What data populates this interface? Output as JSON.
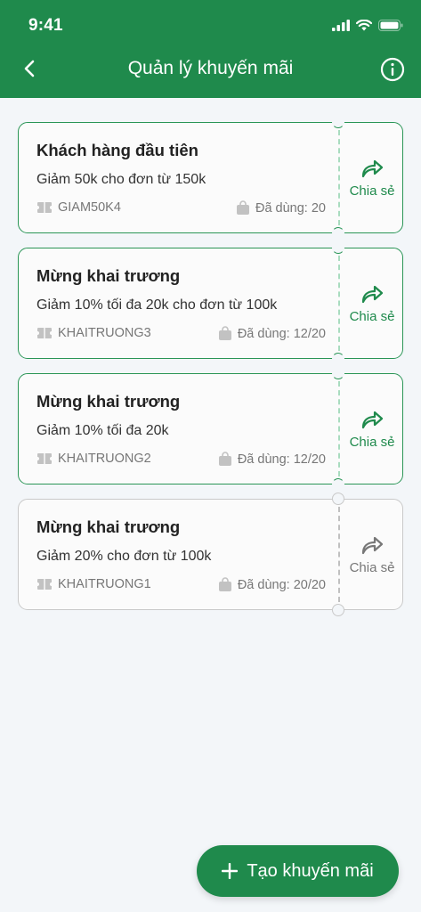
{
  "status_bar": {
    "time": "9:41"
  },
  "nav": {
    "title": "Quản lý khuyến mãi"
  },
  "promotions": [
    {
      "title": "Khách hàng đầu tiên",
      "description": "Giảm 50k cho đơn từ 150k",
      "code": "GIAM50K4",
      "used": "Đã dùng: 20",
      "share_label": "Chia sẻ",
      "active": true
    },
    {
      "title": "Mừng khai trương",
      "description": "Giảm 10% tối đa 20k cho đơn từ 100k",
      "code": "KHAITRUONG3",
      "used": "Đã dùng: 12/20",
      "share_label": "Chia sẻ",
      "active": true
    },
    {
      "title": "Mừng khai trương",
      "description": "Giảm 10% tối đa 20k",
      "code": "KHAITRUONG2",
      "used": "Đã dùng: 12/20",
      "share_label": "Chia sẻ",
      "active": true
    },
    {
      "title": "Mừng khai trương",
      "description": "Giảm 20% cho đơn từ 100k",
      "code": "KHAITRUONG1",
      "used": "Đã dùng: 20/20",
      "share_label": "Chia sẻ",
      "active": false
    }
  ],
  "fab": {
    "label": "Tạo khuyến mãi"
  },
  "colors": {
    "brand": "#1f8a4c",
    "inactive": "#c9c9c9"
  }
}
